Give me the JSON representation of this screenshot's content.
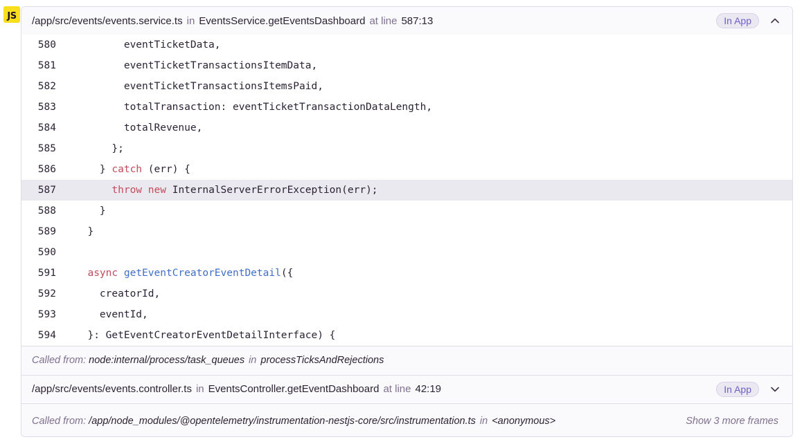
{
  "platform_badge": "JS",
  "frame1": {
    "filename": "/app/src/events/events.service.ts",
    "in_word": "in",
    "function": "EventsService.getEventsDashboard",
    "at_line_label": "at line",
    "line_col": "587:13",
    "in_app_label": "In App",
    "expanded": true
  },
  "code": {
    "active_line": "587",
    "lines": [
      {
        "no": "580",
        "text": "        eventTicketData,"
      },
      {
        "no": "581",
        "text": "        eventTicketTransactionsItemData,"
      },
      {
        "no": "582",
        "text": "        eventTicketTransactionsItemsPaid,"
      },
      {
        "no": "583",
        "text": "        totalTransaction: eventTicketTransactionDataLength,"
      },
      {
        "no": "584",
        "text": "        totalRevenue,"
      },
      {
        "no": "585",
        "text": "      };"
      },
      {
        "no": "586",
        "text": "    } catch (err) {"
      },
      {
        "no": "587",
        "text": "      throw new InternalServerErrorException(err);"
      },
      {
        "no": "588",
        "text": "    }"
      },
      {
        "no": "589",
        "text": "  }"
      },
      {
        "no": "590",
        "text": ""
      },
      {
        "no": "591",
        "text": "  async getEventCreatorEventDetail({"
      },
      {
        "no": "592",
        "text": "    creatorId,"
      },
      {
        "no": "593",
        "text": "    eventId,"
      },
      {
        "no": "594",
        "text": "  }: GetEventCreatorEventDetailInterface) {"
      }
    ]
  },
  "called_from_1": {
    "label": "Called from:",
    "location": "node:internal/process/task_queues",
    "in_word": "in",
    "function": "processTicksAndRejections"
  },
  "frame2": {
    "filename": "/app/src/events/events.controller.ts",
    "in_word": "in",
    "function": "EventsController.getEventDashboard",
    "at_line_label": "at line",
    "line_col": "42:19",
    "in_app_label": "In App",
    "expanded": false
  },
  "called_from_2": {
    "label": "Called from:",
    "location": "/app/node_modules/@opentelemetry/instrumentation-nestjs-core/src/instrumentation.ts",
    "in_word": "in",
    "function": "<anonymous>",
    "show_more_label": "Show 3 more frames"
  },
  "colors": {
    "keyword": "#c14b5b",
    "function_name": "#3e6fc9",
    "highlight_row": "#ebe9f0",
    "in_app_text": "#6c5fc7",
    "js_badge": "#f7df1e"
  }
}
